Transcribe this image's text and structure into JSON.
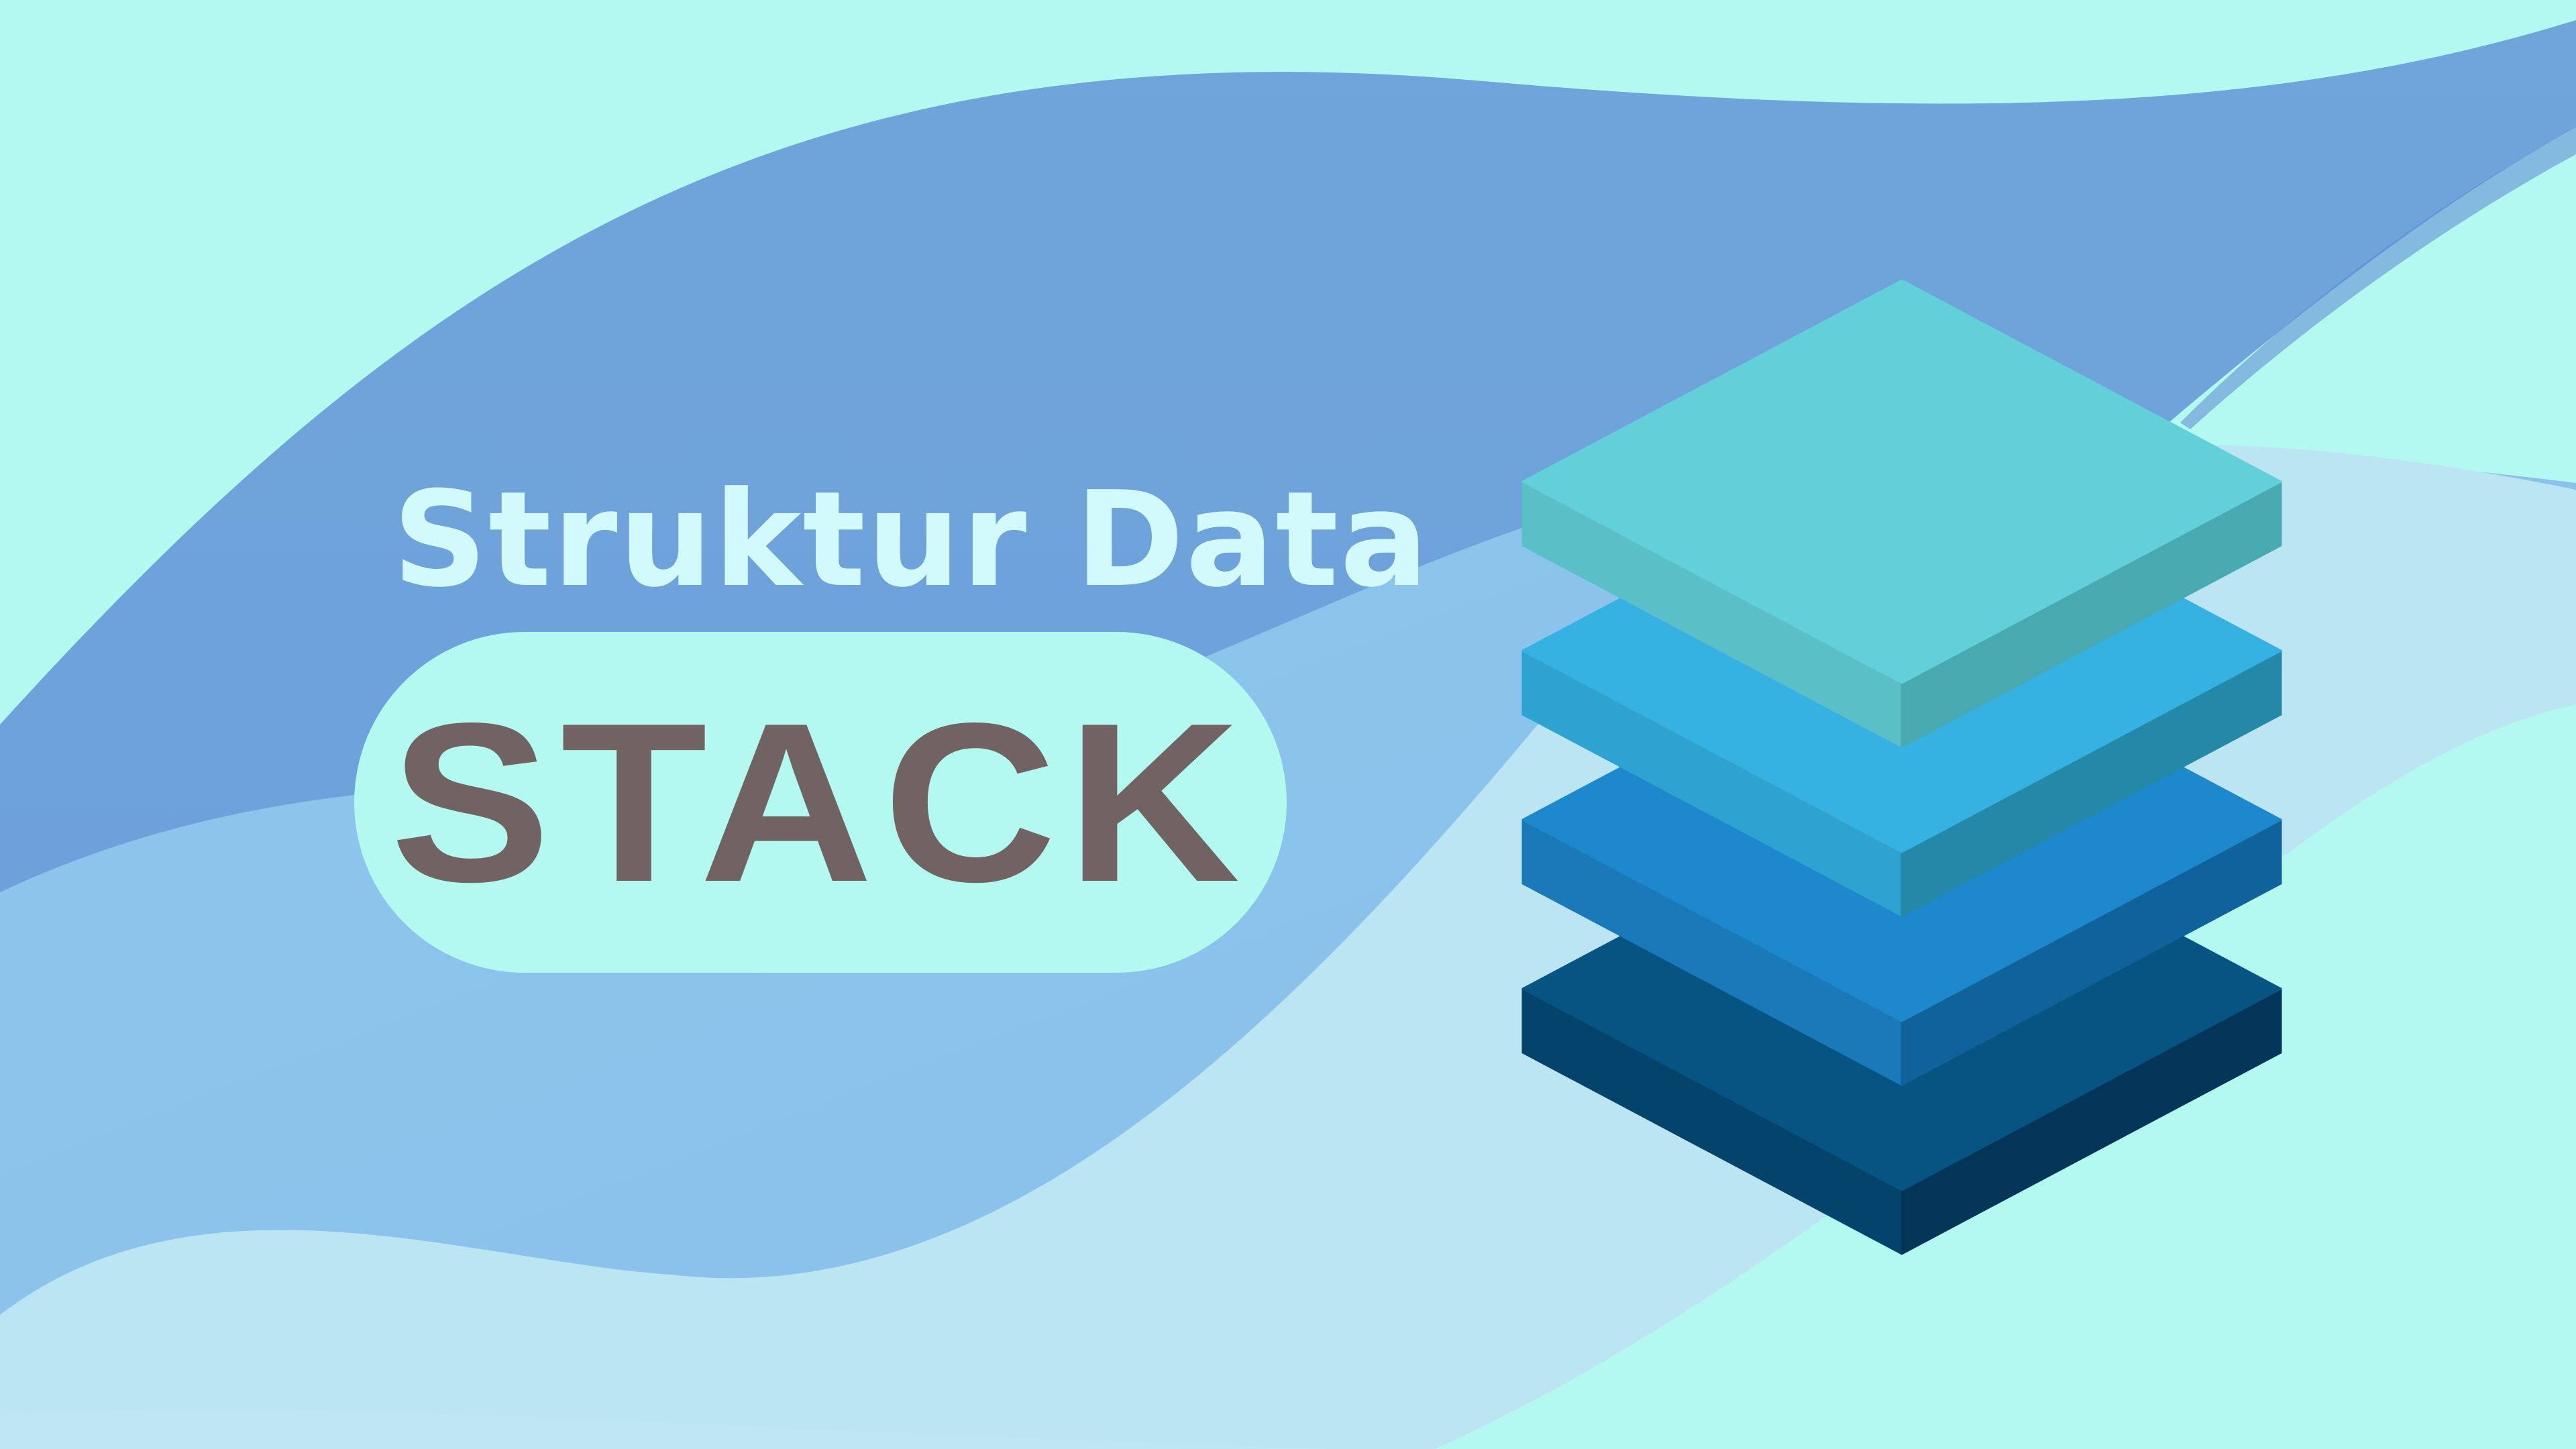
{
  "banner": {
    "subtitle": "Struktur Data",
    "title": "STACK"
  },
  "colors": {
    "background": "#b4f9ef",
    "wave_dark": "#6fa3da",
    "wave_mid": "#8dc4ec",
    "wave_light": "#bce5f3",
    "subtitle_text": "#d2f9fb",
    "title_text": "#706362",
    "pill_background": "#b4f9ef"
  },
  "illustration": {
    "name": "stacked-layers-icon",
    "layers": [
      {
        "name": "layer-1",
        "top": "#63d0d9",
        "left": "#5bbfc8",
        "right": "#48a9b0"
      },
      {
        "name": "layer-2",
        "top": "#35b1e2",
        "left": "#2ea3d0",
        "right": "#2389a6"
      },
      {
        "name": "layer-3",
        "top": "#1d88cb",
        "left": "#1a79b8",
        "right": "#10629a"
      },
      {
        "name": "layer-4",
        "top": "#065482",
        "left": "#04446c",
        "right": "#033558"
      }
    ]
  }
}
